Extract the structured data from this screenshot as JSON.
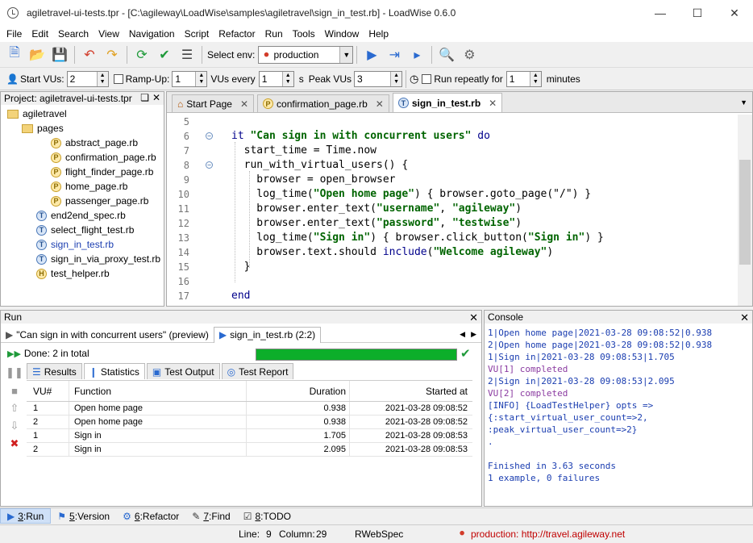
{
  "window": {
    "title": "agiletravel-ui-tests.tpr - [C:\\agileway\\LoadWise\\samples\\agiletravel\\sign_in_test.rb] - LoadWise 0.6.0"
  },
  "menu": [
    "File",
    "Edit",
    "Search",
    "View",
    "Navigation",
    "Script",
    "Refactor",
    "Run",
    "Tools",
    "Window",
    "Help"
  ],
  "toolbar": {
    "select_env_label": "Select env:",
    "env_value": "production"
  },
  "load": {
    "start_vus_label": "Start VUs:",
    "start_vus": "2",
    "rampup_label": "Ramp-Up:",
    "rampup": "1",
    "vus_every_label": "VUs every",
    "vus_every": "1",
    "s_label": "s",
    "peak_label": "Peak VUs",
    "peak": "3",
    "repeat_label": "Run repeatly for",
    "repeat": "1",
    "minutes_label": "minutes"
  },
  "project": {
    "title": "Project: agiletravel-ui-tests.tpr",
    "root": "agiletravel",
    "folder": "pages",
    "pages": [
      "abstract_page.rb",
      "confirmation_page.rb",
      "flight_finder_page.rb",
      "home_page.rb",
      "passenger_page.rb"
    ],
    "tests": [
      "end2end_spec.rb",
      "select_flight_test.rb",
      "sign_in_test.rb",
      "sign_in_via_proxy_test.rb"
    ],
    "helper": "test_helper.rb"
  },
  "editor": {
    "tabs": [
      "Start Page",
      "confirmation_page.rb",
      "sign_in_test.rb"
    ],
    "line_numbers": [
      "5",
      "6",
      "7",
      "8",
      "9",
      "10",
      "11",
      "12",
      "13",
      "14",
      "15",
      "16",
      "17"
    ],
    "lines": [
      {
        "t": ""
      },
      {
        "t": "it ",
        "s": "\"Can sign in with concurrent users\"",
        "e": " do"
      },
      {
        "t": "  start_time = Time.now"
      },
      {
        "t": "  run_with_virtual_users() {"
      },
      {
        "t": "    browser = open_browser"
      },
      {
        "t": "    log_time(",
        "s": "\"Open home page\"",
        "e": ") { browser.goto_page(\"/\") }"
      },
      {
        "t": "    browser.enter_text(",
        "s": "\"username\"",
        "e": ", ",
        "s2": "\"agileway\"",
        "e2": ")"
      },
      {
        "t": "    browser.enter_text(",
        "s": "\"password\"",
        "e": ", ",
        "s2": "\"testwise\"",
        "e2": ")"
      },
      {
        "t": "    log_time(",
        "s": "\"Sign in\"",
        "e": ") { browser.click_button(",
        "s2": "\"Sign in\"",
        "e2": ") }"
      },
      {
        "t": "    browser.text.should include(",
        "s": "\"Welcome agileway\"",
        "e": ")"
      },
      {
        "t": "  }"
      },
      {
        "t": ""
      },
      {
        "t": "end"
      }
    ]
  },
  "run": {
    "title": "Run",
    "tab1": "\"Can sign in with concurrent users\" (preview)",
    "tab2": "sign_in_test.rb (2:2)",
    "done": "Done: 2 in total",
    "subtabs": [
      "Results",
      "Statistics",
      "Test Output",
      "Test Report"
    ],
    "headers": [
      "VU#",
      "Function",
      "Duration",
      "Started at"
    ],
    "rows": [
      [
        "1",
        "Open home page",
        "0.938",
        "2021-03-28 09:08:52"
      ],
      [
        "2",
        "Open home page",
        "0.938",
        "2021-03-28 09:08:52"
      ],
      [
        "1",
        "Sign in",
        "1.705",
        "2021-03-28 09:08:53"
      ],
      [
        "2",
        "Sign in",
        "2.095",
        "2021-03-28 09:08:53"
      ]
    ]
  },
  "console": {
    "title": "Console",
    "lines": [
      {
        "t": "1|Open home page|2021-03-28 09:08:52|0.938",
        "c": "blue"
      },
      {
        "t": "2|Open home page|2021-03-28 09:08:52|0.938",
        "c": "blue"
      },
      {
        "t": "1|Sign in|2021-03-28 09:08:53|1.705",
        "c": "blue"
      },
      {
        "t": "VU[1] completed",
        "c": "pur"
      },
      {
        "t": "2|Sign in|2021-03-28 09:08:53|2.095",
        "c": "blue"
      },
      {
        "t": "VU[2] completed",
        "c": "pur"
      },
      {
        "t": "[INFO] {LoadTestHelper} opts =>",
        "c": "blue"
      },
      {
        "t": "{:start_virtual_user_count=>2,",
        "c": "blue"
      },
      {
        "t": ":peak_virtual_user_count=>2}",
        "c": "blue"
      },
      {
        "t": ".",
        "c": "blue"
      },
      {
        "t": "",
        "c": "blue"
      },
      {
        "t": "Finished in 3.63 seconds",
        "c": "blue"
      },
      {
        "t": "1 example, 0 failures",
        "c": "blue"
      }
    ]
  },
  "bottom_tabs": [
    {
      "num": "3",
      "label": "Run"
    },
    {
      "num": "5",
      "label": "Version"
    },
    {
      "num": "6",
      "label": "Refactor"
    },
    {
      "num": "7",
      "label": "Find"
    },
    {
      "num": "8",
      "label": "TODO"
    }
  ],
  "status": {
    "line_label": "Line:",
    "line": "9",
    "col_label": "Column:",
    "col": "29",
    "lib": "RWebSpec",
    "env": "production: http://travel.agileway.net"
  }
}
